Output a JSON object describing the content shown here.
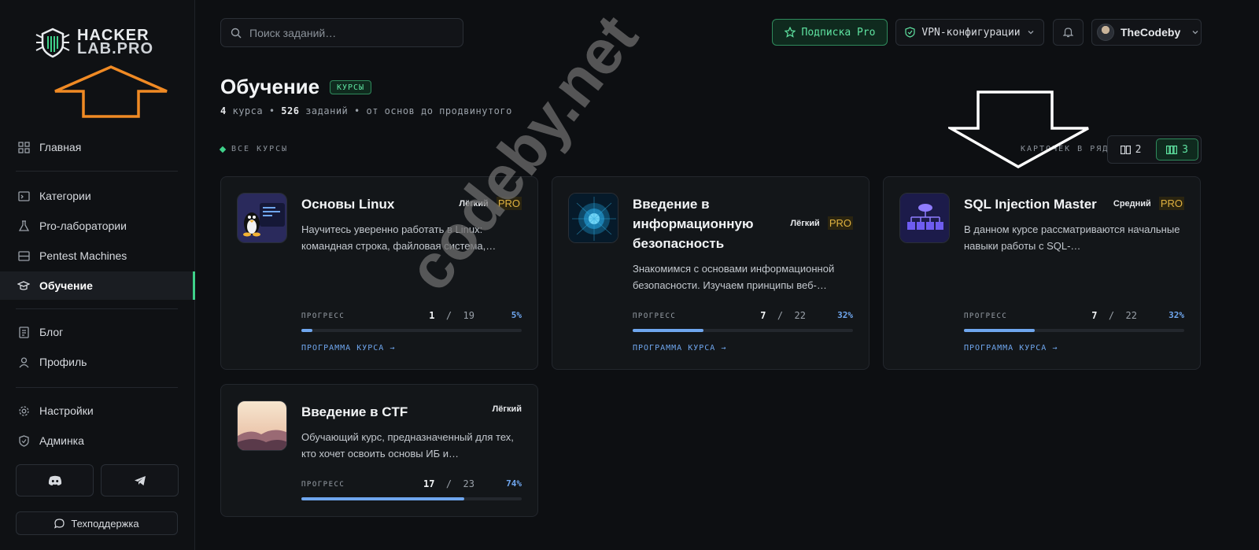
{
  "sidebar": {
    "logo": {
      "line1": "HACKER",
      "line2": "LAB.PRO"
    },
    "nav_main": [
      {
        "label": "Главная",
        "icon": "grid-icon"
      }
    ],
    "nav_group": [
      {
        "label": "Категории",
        "icon": "terminal-icon"
      },
      {
        "label": "Pro-лаборатории",
        "icon": "flask-icon"
      },
      {
        "label": "Pentest Machines",
        "icon": "server-icon"
      },
      {
        "label": "Обучение",
        "icon": "graduation-cap-icon",
        "active": true
      }
    ],
    "nav_group2": [
      {
        "label": "Блог",
        "icon": "document-icon"
      },
      {
        "label": "Профиль",
        "icon": "user-icon"
      }
    ],
    "nav_group3": [
      {
        "label": "Настройки",
        "icon": "gear-icon"
      },
      {
        "label": "Админка",
        "icon": "shield-icon"
      }
    ],
    "support_label": "Техподдержка"
  },
  "header": {
    "search_placeholder": "Поиск заданий…",
    "pro_button": "Подписка Pro",
    "vpn_button": "VPN-конфигурации",
    "username": "TheCodeby"
  },
  "page": {
    "title": "Обучение",
    "badge": "КУРСЫ",
    "subtitle": {
      "courses_count": "4",
      "courses_word": "курса",
      "tasks_count": "526",
      "tasks_word": "заданий",
      "tail": "от основ до продвинутого"
    },
    "section_label": "ВСЕ КУРСЫ",
    "cards_per_row_label": "КАРТОЧЕК В РЯД",
    "toggle_2": "2",
    "toggle_3": "3"
  },
  "courses": [
    {
      "title": "Основы Linux",
      "level": "Лёгкий",
      "pro": "PRO",
      "description": "Научитесь уверенно работать в Linux: командная строка, файловая система,…",
      "progress_label": "ПРОГРЕСС",
      "done": "1",
      "total": "19",
      "percent": "5%",
      "fraction": 0.05,
      "program_link": "ПРОГРАММА КУРСА →"
    },
    {
      "title": "Введение в информационную безопасность",
      "level": "Лёгкий",
      "pro": "PRO",
      "description": "Знакомимся с основами информационной безопасности. Изучаем принципы веб-…",
      "progress_label": "ПРОГРЕСС",
      "done": "7",
      "total": "22",
      "percent": "32%",
      "fraction": 0.32,
      "program_link": "ПРОГРАММА КУРСА →"
    },
    {
      "title": "SQL Injection Master",
      "level": "Средний",
      "pro": "PRO",
      "description": "В данном курсе рассматриваются начальные навыки работы с SQL-…",
      "progress_label": "ПРОГРЕСС",
      "done": "7",
      "total": "22",
      "percent": "32%",
      "fraction": 0.32,
      "program_link": "ПРОГРАММА КУРСА →"
    },
    {
      "title": "Введение в CTF",
      "level": "Лёгкий",
      "description": "Обучающий курс, предназначенный для тех, кто хочет освоить основы ИБ и…",
      "progress_label": "ПРОГРЕСС",
      "done": "17",
      "total": "23",
      "percent": "74%",
      "fraction": 0.74
    }
  ],
  "watermark": "codeby.net",
  "colors": {
    "accent_green": "#3fd18a",
    "progress_blue": "#6fa6ee",
    "pro_gold": "#e0b240",
    "arrow_orange": "#f08a24"
  }
}
